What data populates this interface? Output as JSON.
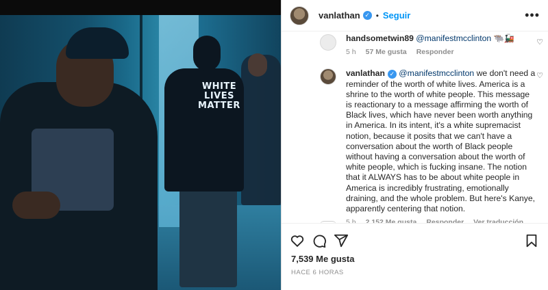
{
  "post": {
    "author": "vanlathan",
    "follow_label": "Seguir",
    "separator": "•",
    "more_icon": "more-options-icon"
  },
  "image": {
    "shirt_text": "WHITE\nLIVES\nMATTER"
  },
  "comments": [
    {
      "user": "handsometwin89",
      "mention": "@manifestmcclinton",
      "text": "🐃🚂",
      "time": "5 h",
      "likes": "57 Me gusta",
      "reply": "Responder"
    },
    {
      "user": "vanlathan",
      "mention": "@manifestmcclinton",
      "text": "we don't need a reminder of the worth of white lives. America is a shrine to the worth of white people. This message is reactionary to a message affirming the worth of Black lives, which have never been worth anything in America. In its intent, it's a white supremacist notion, because it posits that we can't have a conversation about the worth of Black people without having a conversation about the worth of white people, which is fucking insane. The notion that it ALWAYS has to be about white people in America is incredibly frustrating, emotionally draining, and the whole problem. But here's Kanye, apparently centering that notion.",
      "time": "5 h",
      "likes": "2,152 Me gusta",
      "reply": "Responder",
      "translate": "Ver traducción"
    }
  ],
  "footer": {
    "likes": "7,539 Me gusta",
    "time": "HACE 6 HORAS"
  },
  "colors": {
    "accent": "#0095f6",
    "verified": "#3897f0",
    "mention": "#00376b",
    "muted": "#8e8e8e"
  }
}
